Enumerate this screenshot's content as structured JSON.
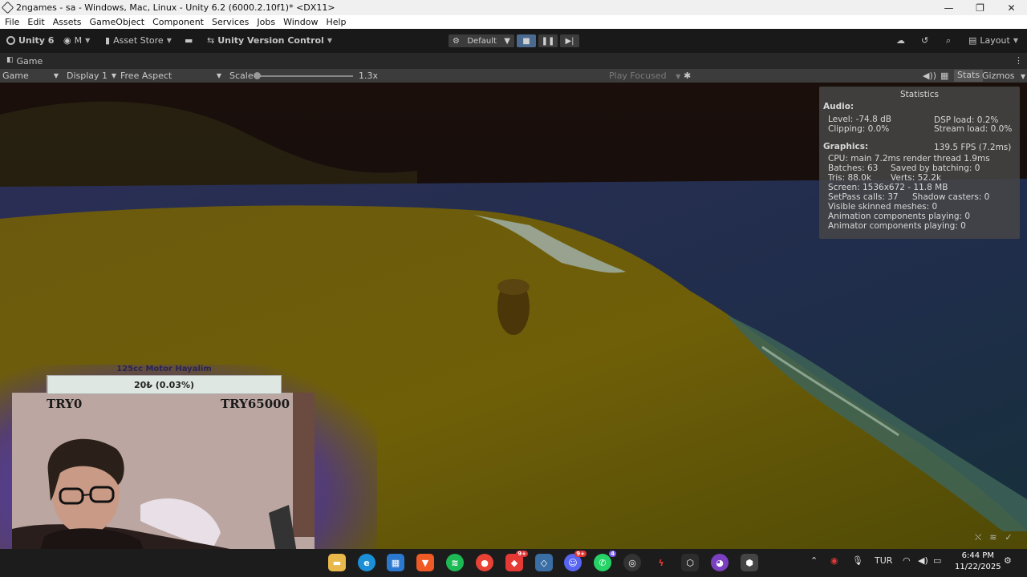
{
  "window": {
    "title": "2ngames - sa - Windows, Mac, Linux - Unity 6.2 (6000.2.10f1)* <DX11>",
    "minimize": "—",
    "maximize": "❐",
    "close": "✕"
  },
  "menu": [
    "File",
    "Edit",
    "Assets",
    "GameObject",
    "Component",
    "Services",
    "Jobs",
    "Window",
    "Help"
  ],
  "toolbar": {
    "unity_label": "Unity 6",
    "account_label": "M",
    "asset_store_label": "Asset Store",
    "version_control_label": "Unity Version Control",
    "play_mode_label": "Default",
    "layout_label": "Layout"
  },
  "tab": {
    "label": "Game"
  },
  "gamebar": {
    "view_label": "Game",
    "display_label": "Display 1",
    "aspect_label": "Free Aspect",
    "scale_label": "Scale",
    "scale_value": "1.3x",
    "scale_fraction": 0.0,
    "play_focused_label": "Play Focused",
    "stats_label": "Stats",
    "gizmos_label": "Gizmos"
  },
  "statistics": {
    "title": "Statistics",
    "audio_header": "Audio:",
    "level": "Level: -74.8 dB",
    "clipping": "Clipping: 0.0%",
    "dsp_load": "DSP load: 0.2%",
    "stream_load": "Stream load: 0.0%",
    "graphics_header": "Graphics:",
    "fps": "139.5 FPS (7.2ms)",
    "cpu": "CPU: main 7.2ms  render thread 1.9ms",
    "batches": "Batches: 63",
    "saved_batching": "Saved by batching: 0",
    "tris": "Tris: 88.0k",
    "verts": "Verts: 52.2k",
    "screen": "Screen: 1536x672 - 11.8 MB",
    "setpass": "SetPass calls: 37",
    "shadow_casters": "Shadow casters: 0",
    "skinned_meshes": "Visible skinned meshes: 0",
    "animation_components": "Animation components playing: 0",
    "animator_components": "Animator components playing: 0"
  },
  "donation_goal": {
    "title": "125cc Motor Hayalim",
    "progress_text": "20₺ (0.03%)",
    "progress_fraction": 0.0003,
    "min_label": "TRY0",
    "max_label": "TRY65000"
  },
  "taskbar": {
    "apps": [
      "file-explorer",
      "edge",
      "store",
      "brave",
      "spotify",
      "chrome",
      "app-9plus",
      "app-diamond",
      "discord",
      "whatsapp",
      "app-circle",
      "app-lightning",
      "unity-hub",
      "github",
      "unity"
    ],
    "badges": {
      "chrome_badge": "9+",
      "discord_badge": "9+",
      "whatsapp_badge": "4"
    },
    "language": "TUR",
    "time": "6:44 PM",
    "date": "11/22/2025"
  }
}
